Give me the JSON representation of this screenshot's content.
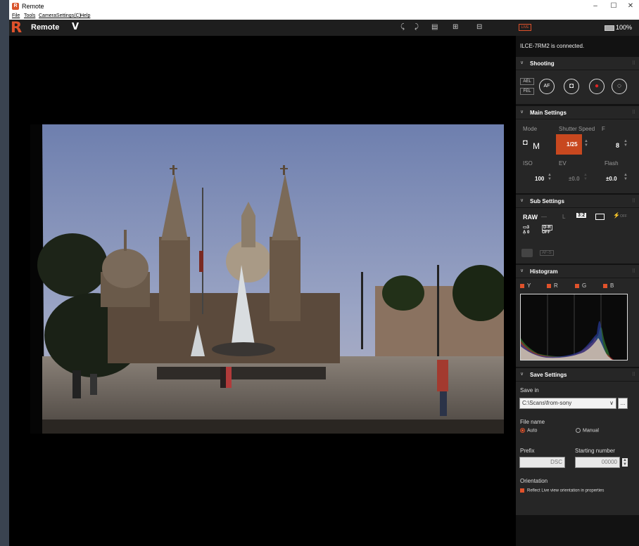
{
  "window": {
    "title": "Remote",
    "menu": [
      "File",
      "Tools",
      "CameraSettings(C)",
      "Help"
    ],
    "minimize": "–",
    "maximize": "☐",
    "close": "✕"
  },
  "toolbar": {
    "logo": "R",
    "title": "Remote",
    "v_label": "V",
    "live_badge": "LIVE",
    "battery": "100%"
  },
  "panel": {
    "connection_status": "ILCE-7RM2 is connected.",
    "shooting": {
      "title": "Shooting",
      "ael": "AEL",
      "fel": "FEL",
      "af": "AF"
    },
    "main_settings": {
      "title": "Main Settings",
      "mode_label": "Mode",
      "mode_value": "M",
      "shutter_label": "Shutter Speed",
      "shutter_value": "1/25",
      "f_label": "F",
      "f_value": "8",
      "iso_label": "ISO",
      "iso_value": "100",
      "ev_label": "EV",
      "ev_value": "±0.0",
      "flash_label": "Flash",
      "flash_value": "±0.0"
    },
    "sub_settings": {
      "title": "Sub Settings",
      "raw": "RAW",
      "dash": "—",
      "size": "L",
      "aspect": "3:2",
      "flash_off": "OFF",
      "dr": "D-R",
      "dr_value": "OFF",
      "wb": "3",
      "awb": "A̱ 0",
      "afs": "AF-S"
    },
    "histogram": {
      "title": "Histogram",
      "channels": [
        "Y",
        "R",
        "G",
        "B"
      ]
    },
    "save_settings": {
      "title": "Save Settings",
      "save_in_label": "Save in",
      "save_in_value": "C:\\Scans\\from-sony",
      "browse": "...",
      "file_name_label": "File name",
      "auto": "Auto",
      "manual": "Manual",
      "prefix_label": "Prefix",
      "prefix_value": "DSC",
      "starting_number_label": "Starting number",
      "starting_number_value": "00000",
      "orientation_label": "Orientation",
      "orientation_check": "Reflect Live view orientation in properties"
    }
  },
  "colors": {
    "accent": "#e0522b",
    "panel_bg": "#262626",
    "toolbar_bg": "#1e1e1e"
  }
}
